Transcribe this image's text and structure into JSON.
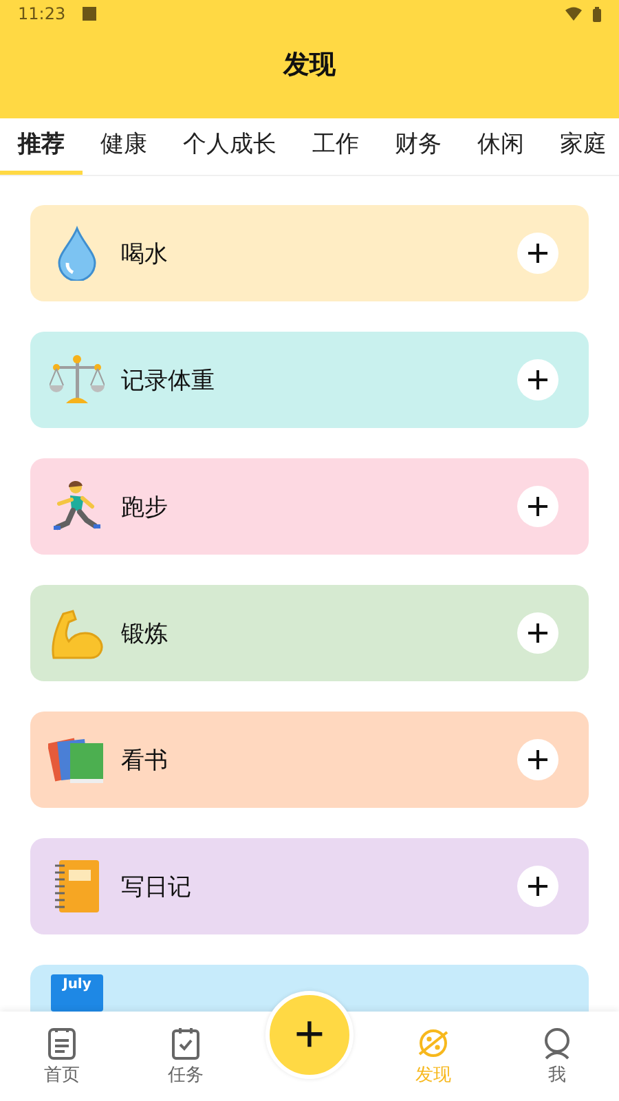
{
  "status_bar": {
    "time": "11:23"
  },
  "header": {
    "title": "发现"
  },
  "tabs": [
    {
      "label": "推荐",
      "selected": true
    },
    {
      "label": "健康",
      "selected": false
    },
    {
      "label": "个人成长",
      "selected": false
    },
    {
      "label": "工作",
      "selected": false
    },
    {
      "label": "财务",
      "selected": false
    },
    {
      "label": "休闲",
      "selected": false
    },
    {
      "label": "家庭",
      "selected": false
    }
  ],
  "cards": [
    {
      "title": "喝水",
      "kind": "droplet",
      "color": "#ffedc4"
    },
    {
      "title": "记录体重",
      "kind": "scale",
      "color": "#c9f1ee"
    },
    {
      "title": "跑步",
      "kind": "runner",
      "color": "#fdd9e2"
    },
    {
      "title": "锻炼",
      "kind": "muscle",
      "color": "#d6ead1"
    },
    {
      "title": "看书",
      "kind": "books",
      "color": "#ffd8bf"
    },
    {
      "title": "写日记",
      "kind": "notebook",
      "color": "#ead9f2"
    },
    {
      "kind": "calendar",
      "icon_text": "July",
      "color": "#c7ebfb"
    }
  ],
  "bottom_nav": [
    {
      "label": "首页",
      "kind": "doc",
      "selected": false
    },
    {
      "label": "任务",
      "kind": "task",
      "selected": false
    },
    {
      "label": "发现",
      "kind": "planet",
      "selected": true
    },
    {
      "label": "我",
      "kind": "user",
      "selected": false
    }
  ],
  "fab": {
    "label": "+"
  }
}
